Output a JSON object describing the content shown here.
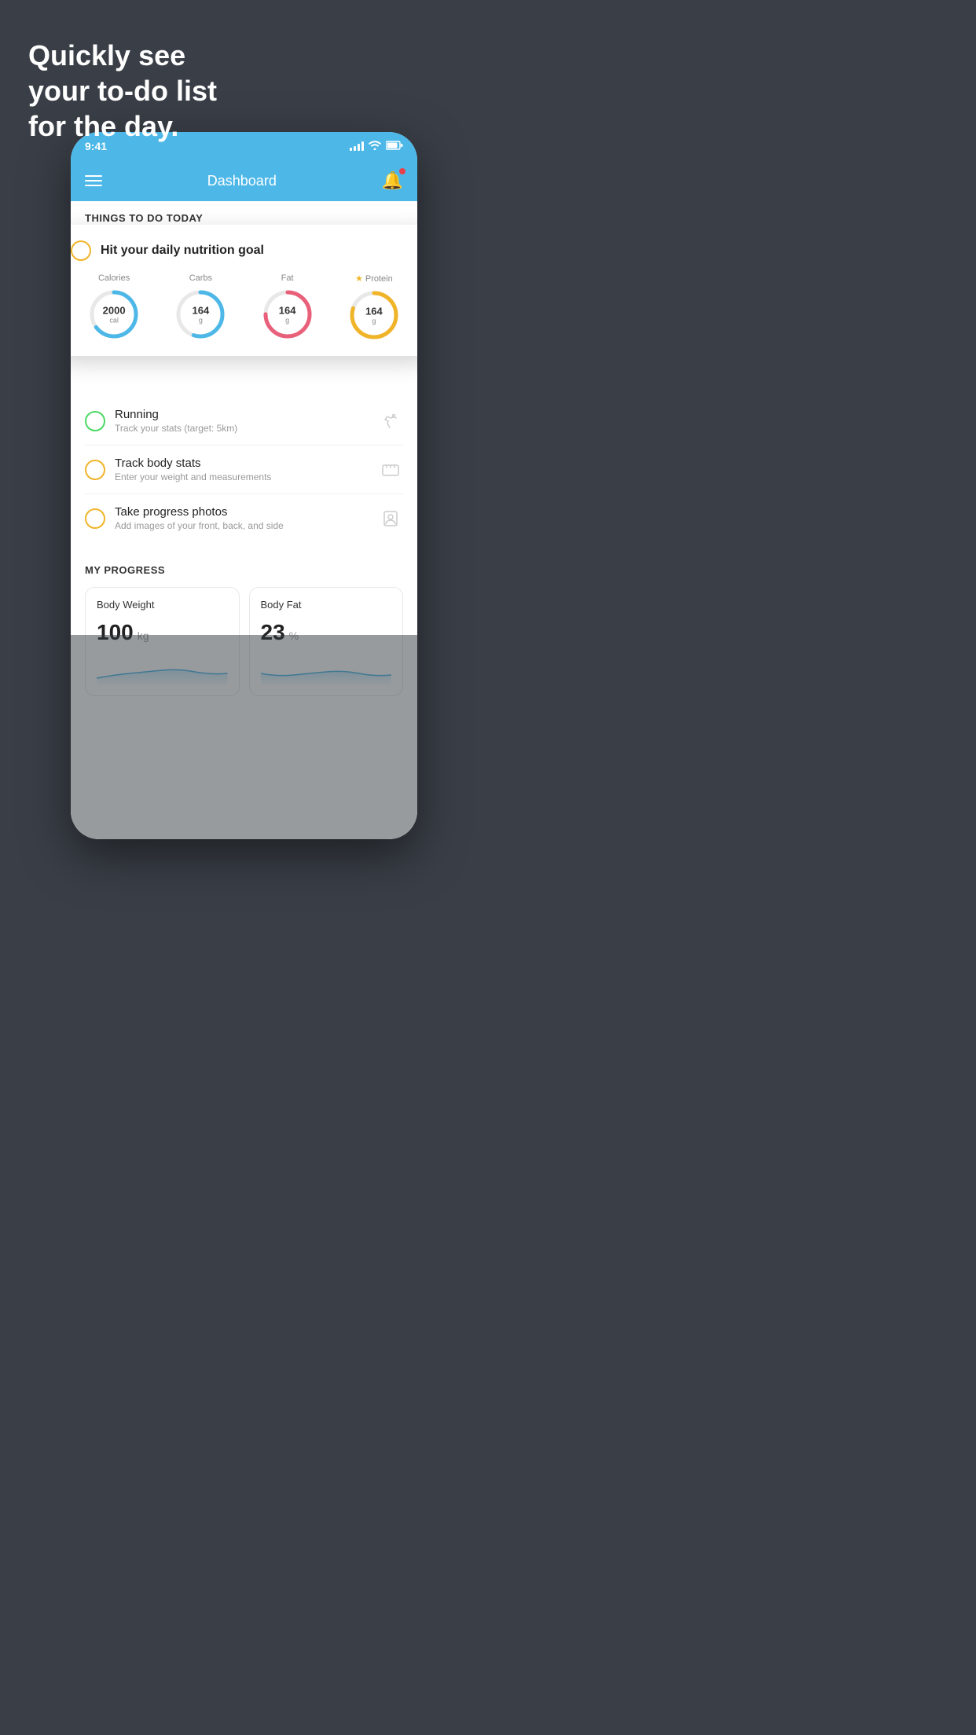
{
  "background_text": {
    "line1": "Quickly see",
    "line2": "your to-do list",
    "line3": "for the day."
  },
  "status_bar": {
    "time": "9:41",
    "signal_label": "signal",
    "wifi_label": "wifi",
    "battery_label": "battery"
  },
  "nav": {
    "title": "Dashboard",
    "menu_label": "menu",
    "bell_label": "notifications"
  },
  "section_today": {
    "header": "THINGS TO DO TODAY"
  },
  "floating_card": {
    "title": "Hit your daily nutrition goal",
    "macros": [
      {
        "label": "Calories",
        "value": "2000",
        "unit": "cal",
        "color": "#4db8e8",
        "percent": 65,
        "starred": false
      },
      {
        "label": "Carbs",
        "value": "164",
        "unit": "g",
        "color": "#4db8e8",
        "percent": 55,
        "starred": false
      },
      {
        "label": "Fat",
        "value": "164",
        "unit": "g",
        "color": "#e8607a",
        "percent": 75,
        "starred": false
      },
      {
        "label": "Protein",
        "value": "164",
        "unit": "g",
        "color": "#f0b429",
        "percent": 80,
        "starred": true
      }
    ]
  },
  "todo_items": [
    {
      "title": "Running",
      "subtitle": "Track your stats (target: 5km)",
      "checkbox_color": "green",
      "icon": "shoe"
    },
    {
      "title": "Track body stats",
      "subtitle": "Enter your weight and measurements",
      "checkbox_color": "yellow",
      "icon": "scale"
    },
    {
      "title": "Take progress photos",
      "subtitle": "Add images of your front, back, and side",
      "checkbox_color": "yellow",
      "icon": "portrait"
    }
  ],
  "progress_section": {
    "header": "MY PROGRESS",
    "cards": [
      {
        "title": "Body Weight",
        "value": "100",
        "unit": "kg"
      },
      {
        "title": "Body Fat",
        "value": "23",
        "unit": "%"
      }
    ]
  }
}
